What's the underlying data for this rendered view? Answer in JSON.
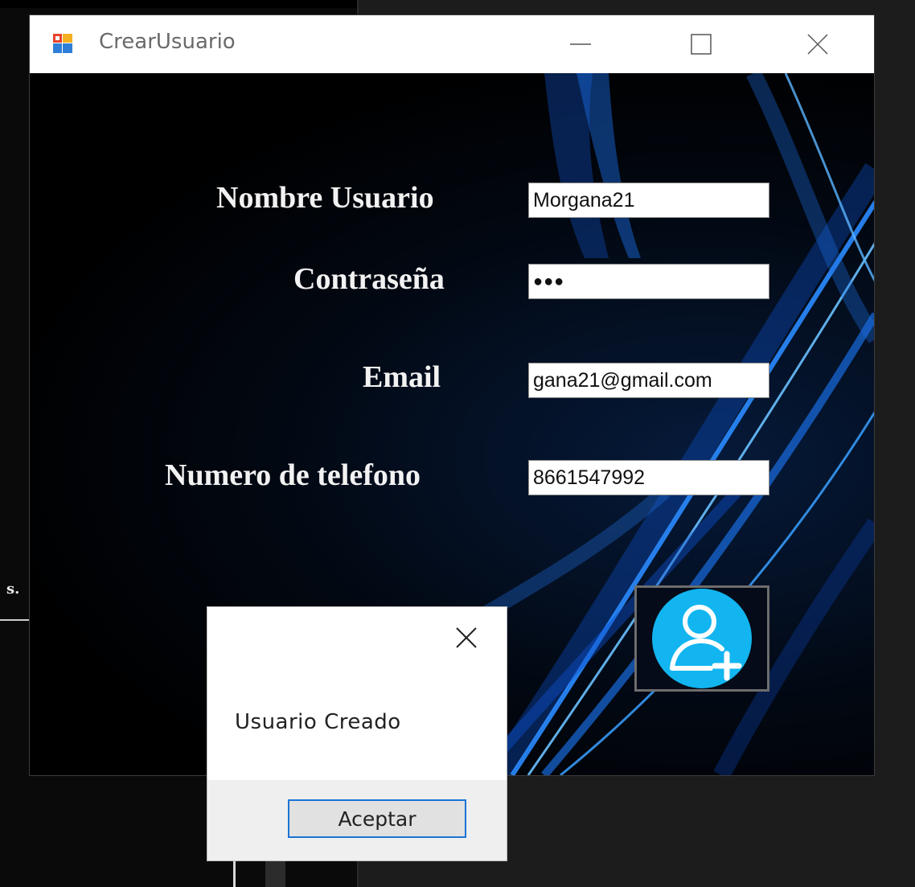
{
  "window": {
    "title": "CrearUsuario"
  },
  "form": {
    "username_label": "Nombre Usuario",
    "username_value": "Morgana21",
    "password_label": "Contraseña",
    "password_value": "●●●",
    "email_label": "Email",
    "email_value": "gana21@gmail.com",
    "phone_label": "Numero de telefono",
    "phone_value": "8661547992"
  },
  "dialog": {
    "message": "Usuario Creado",
    "ok_label": "Aceptar"
  },
  "background": {
    "snippet_text": "s."
  },
  "colors": {
    "accent_blue": "#1a74d4",
    "add_user_circle": "#12b5f0"
  },
  "icons": {
    "app": "app-form-icon",
    "add_user": "add-user-icon",
    "minimize": "minimize-icon",
    "maximize": "maximize-icon",
    "close": "close-icon"
  }
}
